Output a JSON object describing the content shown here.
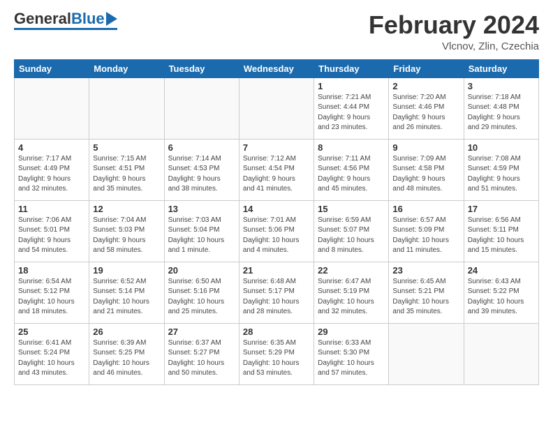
{
  "header": {
    "logo_general": "General",
    "logo_blue": "Blue",
    "month_title": "February 2024",
    "location": "Vlcnov, Zlin, Czechia"
  },
  "weekdays": [
    "Sunday",
    "Monday",
    "Tuesday",
    "Wednesday",
    "Thursday",
    "Friday",
    "Saturday"
  ],
  "weeks": [
    [
      {
        "day": "",
        "info": ""
      },
      {
        "day": "",
        "info": ""
      },
      {
        "day": "",
        "info": ""
      },
      {
        "day": "",
        "info": ""
      },
      {
        "day": "1",
        "info": "Sunrise: 7:21 AM\nSunset: 4:44 PM\nDaylight: 9 hours\nand 23 minutes."
      },
      {
        "day": "2",
        "info": "Sunrise: 7:20 AM\nSunset: 4:46 PM\nDaylight: 9 hours\nand 26 minutes."
      },
      {
        "day": "3",
        "info": "Sunrise: 7:18 AM\nSunset: 4:48 PM\nDaylight: 9 hours\nand 29 minutes."
      }
    ],
    [
      {
        "day": "4",
        "info": "Sunrise: 7:17 AM\nSunset: 4:49 PM\nDaylight: 9 hours\nand 32 minutes."
      },
      {
        "day": "5",
        "info": "Sunrise: 7:15 AM\nSunset: 4:51 PM\nDaylight: 9 hours\nand 35 minutes."
      },
      {
        "day": "6",
        "info": "Sunrise: 7:14 AM\nSunset: 4:53 PM\nDaylight: 9 hours\nand 38 minutes."
      },
      {
        "day": "7",
        "info": "Sunrise: 7:12 AM\nSunset: 4:54 PM\nDaylight: 9 hours\nand 41 minutes."
      },
      {
        "day": "8",
        "info": "Sunrise: 7:11 AM\nSunset: 4:56 PM\nDaylight: 9 hours\nand 45 minutes."
      },
      {
        "day": "9",
        "info": "Sunrise: 7:09 AM\nSunset: 4:58 PM\nDaylight: 9 hours\nand 48 minutes."
      },
      {
        "day": "10",
        "info": "Sunrise: 7:08 AM\nSunset: 4:59 PM\nDaylight: 9 hours\nand 51 minutes."
      }
    ],
    [
      {
        "day": "11",
        "info": "Sunrise: 7:06 AM\nSunset: 5:01 PM\nDaylight: 9 hours\nand 54 minutes."
      },
      {
        "day": "12",
        "info": "Sunrise: 7:04 AM\nSunset: 5:03 PM\nDaylight: 9 hours\nand 58 minutes."
      },
      {
        "day": "13",
        "info": "Sunrise: 7:03 AM\nSunset: 5:04 PM\nDaylight: 10 hours\nand 1 minute."
      },
      {
        "day": "14",
        "info": "Sunrise: 7:01 AM\nSunset: 5:06 PM\nDaylight: 10 hours\nand 4 minutes."
      },
      {
        "day": "15",
        "info": "Sunrise: 6:59 AM\nSunset: 5:07 PM\nDaylight: 10 hours\nand 8 minutes."
      },
      {
        "day": "16",
        "info": "Sunrise: 6:57 AM\nSunset: 5:09 PM\nDaylight: 10 hours\nand 11 minutes."
      },
      {
        "day": "17",
        "info": "Sunrise: 6:56 AM\nSunset: 5:11 PM\nDaylight: 10 hours\nand 15 minutes."
      }
    ],
    [
      {
        "day": "18",
        "info": "Sunrise: 6:54 AM\nSunset: 5:12 PM\nDaylight: 10 hours\nand 18 minutes."
      },
      {
        "day": "19",
        "info": "Sunrise: 6:52 AM\nSunset: 5:14 PM\nDaylight: 10 hours\nand 21 minutes."
      },
      {
        "day": "20",
        "info": "Sunrise: 6:50 AM\nSunset: 5:16 PM\nDaylight: 10 hours\nand 25 minutes."
      },
      {
        "day": "21",
        "info": "Sunrise: 6:48 AM\nSunset: 5:17 PM\nDaylight: 10 hours\nand 28 minutes."
      },
      {
        "day": "22",
        "info": "Sunrise: 6:47 AM\nSunset: 5:19 PM\nDaylight: 10 hours\nand 32 minutes."
      },
      {
        "day": "23",
        "info": "Sunrise: 6:45 AM\nSunset: 5:21 PM\nDaylight: 10 hours\nand 35 minutes."
      },
      {
        "day": "24",
        "info": "Sunrise: 6:43 AM\nSunset: 5:22 PM\nDaylight: 10 hours\nand 39 minutes."
      }
    ],
    [
      {
        "day": "25",
        "info": "Sunrise: 6:41 AM\nSunset: 5:24 PM\nDaylight: 10 hours\nand 43 minutes."
      },
      {
        "day": "26",
        "info": "Sunrise: 6:39 AM\nSunset: 5:25 PM\nDaylight: 10 hours\nand 46 minutes."
      },
      {
        "day": "27",
        "info": "Sunrise: 6:37 AM\nSunset: 5:27 PM\nDaylight: 10 hours\nand 50 minutes."
      },
      {
        "day": "28",
        "info": "Sunrise: 6:35 AM\nSunset: 5:29 PM\nDaylight: 10 hours\nand 53 minutes."
      },
      {
        "day": "29",
        "info": "Sunrise: 6:33 AM\nSunset: 5:30 PM\nDaylight: 10 hours\nand 57 minutes."
      },
      {
        "day": "",
        "info": ""
      },
      {
        "day": "",
        "info": ""
      }
    ]
  ]
}
